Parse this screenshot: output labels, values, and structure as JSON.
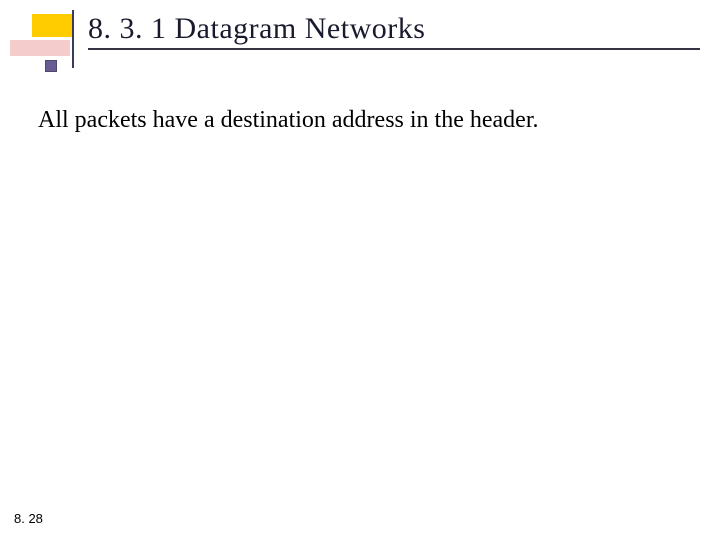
{
  "slide": {
    "title": "8. 3. 1  Datagram Networks",
    "body": "All packets have a destination address in the header.",
    "footer": "8. 28"
  }
}
